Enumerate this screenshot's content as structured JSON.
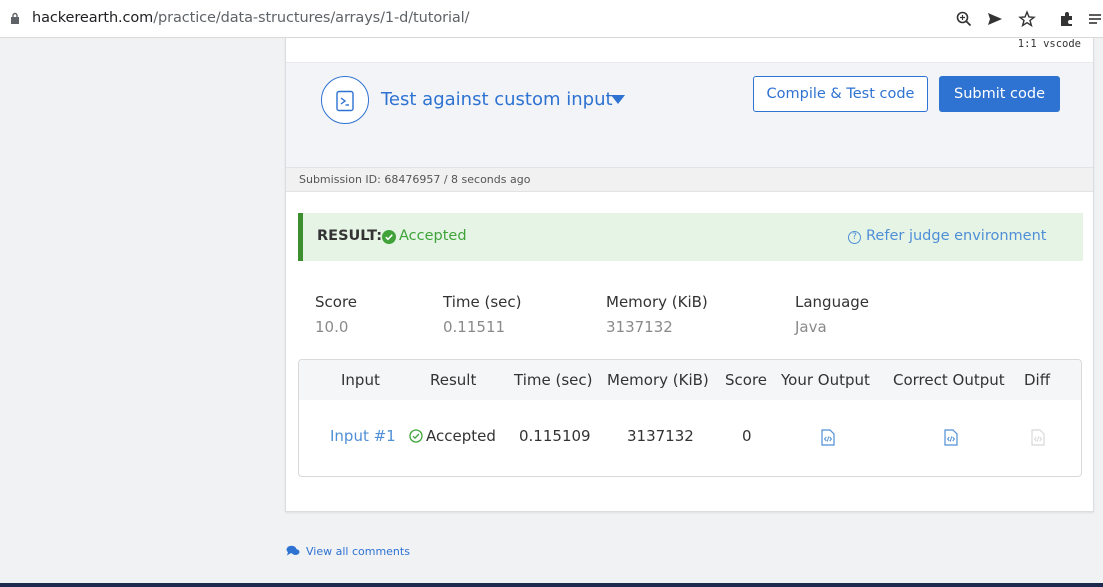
{
  "browser": {
    "url_domain": "hackerearth.com",
    "url_path": "/practice/data-structures/arrays/1-d/tutorial/",
    "icons": [
      "lock-icon",
      "zoom-icon",
      "share-icon",
      "bookmark-star-icon",
      "extensions-icon",
      "menu-icon"
    ]
  },
  "editor": {
    "status": "1:1  vscode"
  },
  "test_bar": {
    "label": "Test against custom input",
    "compile_button": "Compile & Test code",
    "submit_button": "Submit code"
  },
  "submission": {
    "info": "Submission ID: 68476957 / 8 seconds ago"
  },
  "result": {
    "label": "RESULT:",
    "status": "Accepted",
    "refer_link": "Refer judge environment"
  },
  "summary": {
    "score_label": "Score",
    "score": "10.0",
    "time_label": "Time (sec)",
    "time": "0.11511",
    "memory_label": "Memory (KiB)",
    "memory": "3137132",
    "language_label": "Language",
    "language": "Java"
  },
  "table": {
    "headers": [
      "Input",
      "Result",
      "Time (sec)",
      "Memory (KiB)",
      "Score",
      "Your Output",
      "Correct Output",
      "Diff"
    ],
    "rows": [
      {
        "input": "Input #1",
        "result": "Accepted",
        "time": "0.115109",
        "memory": "3137132",
        "score": "0"
      }
    ]
  },
  "footer": {
    "comments_link": "View all comments"
  },
  "colors": {
    "accent": "#2e72d2",
    "success": "#3fa33a",
    "result_bg": "#e6f4e6",
    "link": "#4f8fd6"
  }
}
